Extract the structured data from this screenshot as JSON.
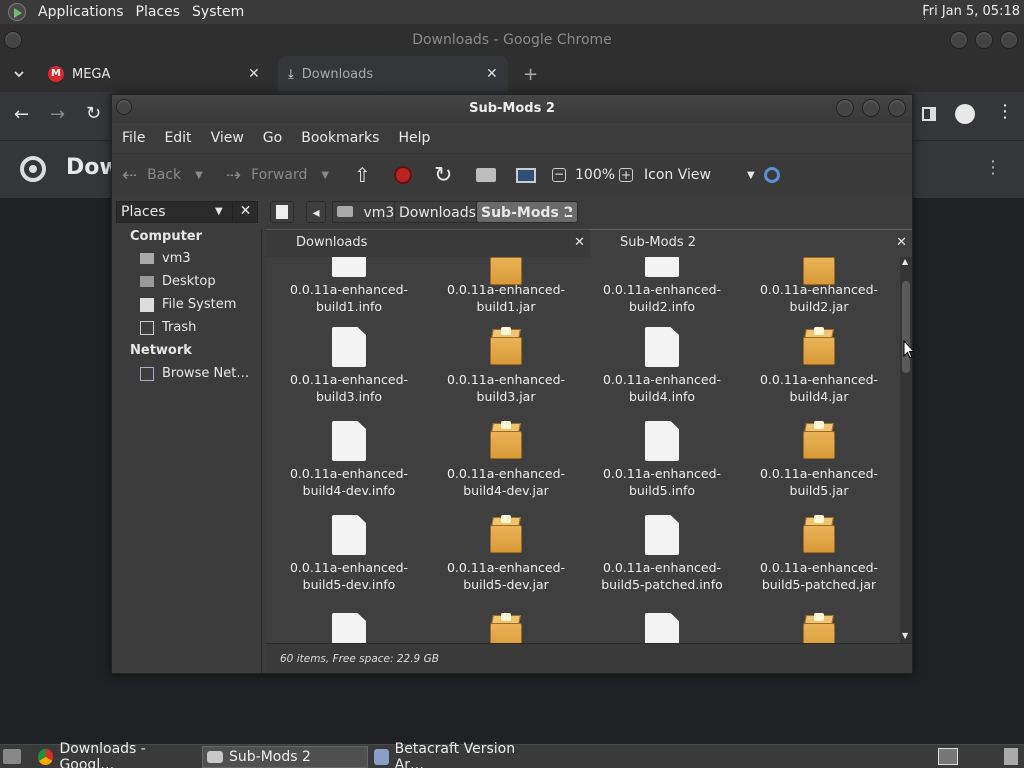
{
  "top_panel": {
    "menus": [
      "Applications",
      "Places",
      "System"
    ],
    "clock": "Fri Jan  5, 05:18"
  },
  "chrome": {
    "window_title": "Downloads - Google Chrome",
    "tabs": [
      {
        "label": "MEGA"
      },
      {
        "label": "Downloads"
      }
    ],
    "new_tab": "+",
    "page_title": "Dow"
  },
  "file_manager": {
    "title": "Sub-Mods 2",
    "menus": [
      "File",
      "Edit",
      "View",
      "Go",
      "Bookmarks",
      "Help"
    ],
    "toolbar": {
      "back": "Back",
      "forward": "Forward",
      "zoom": "100%",
      "view_mode": "Icon View"
    },
    "places_label": "Places",
    "breadcrumbs": [
      "vm3",
      "Downloads",
      "Sub-Mods 2"
    ],
    "sidebar": {
      "computer_heading": "Computer",
      "computer_items": [
        "vm3",
        "Desktop",
        "File System",
        "Trash"
      ],
      "network_heading": "Network",
      "network_items": [
        "Browse Net…"
      ]
    },
    "tabs": [
      "Downloads",
      "Sub-Mods 2"
    ],
    "files": [
      {
        "line1": "0.0.11a-enhanced-",
        "line2": "build1.info",
        "kind": "doc"
      },
      {
        "line1": "0.0.11a-enhanced-",
        "line2": "build1.jar",
        "kind": "jar"
      },
      {
        "line1": "0.0.11a-enhanced-",
        "line2": "build2.info",
        "kind": "doc"
      },
      {
        "line1": "0.0.11a-enhanced-",
        "line2": "build2.jar",
        "kind": "jar"
      },
      {
        "line1": "0.0.11a-enhanced-",
        "line2": "build3.info",
        "kind": "doc"
      },
      {
        "line1": "0.0.11a-enhanced-",
        "line2": "build3.jar",
        "kind": "jar"
      },
      {
        "line1": "0.0.11a-enhanced-",
        "line2": "build4.info",
        "kind": "doc"
      },
      {
        "line1": "0.0.11a-enhanced-",
        "line2": "build4.jar",
        "kind": "jar"
      },
      {
        "line1": "0.0.11a-enhanced-",
        "line2": "build4-dev.info",
        "kind": "doc"
      },
      {
        "line1": "0.0.11a-enhanced-",
        "line2": "build4-dev.jar",
        "kind": "jar"
      },
      {
        "line1": "0.0.11a-enhanced-",
        "line2": "build5.info",
        "kind": "doc"
      },
      {
        "line1": "0.0.11a-enhanced-",
        "line2": "build5.jar",
        "kind": "jar"
      },
      {
        "line1": "0.0.11a-enhanced-",
        "line2": "build5-dev.info",
        "kind": "doc"
      },
      {
        "line1": "0.0.11a-enhanced-",
        "line2": "build5-dev.jar",
        "kind": "jar"
      },
      {
        "line1": "0.0.11a-enhanced-",
        "line2": "build5-patched.info",
        "kind": "doc"
      },
      {
        "line1": "0.0.11a-enhanced-",
        "line2": "build5-patched.jar",
        "kind": "jar"
      }
    ],
    "status": "60 items, Free space: 22.9 GB"
  },
  "taskbar": {
    "tasks": [
      "Downloads - Googl…",
      "Sub-Mods 2",
      "Betacraft Version Ar…"
    ]
  },
  "colors": {
    "panel": "#3a3a3a",
    "chrome_bg": "#202124",
    "jar_orange": "#e2a645",
    "doc_white": "#f4f4f4"
  }
}
